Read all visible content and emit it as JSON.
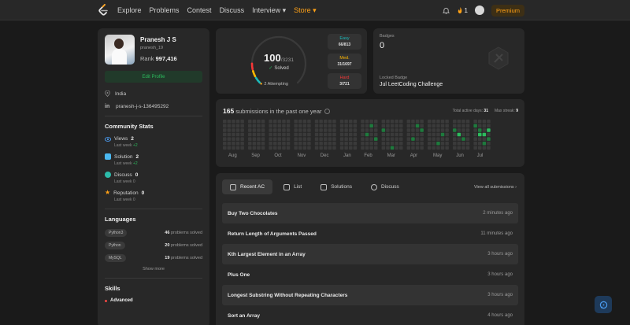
{
  "nav": {
    "links": [
      "Explore",
      "Problems",
      "Contest",
      "Discuss",
      "Interview ▾",
      "Store ▾"
    ],
    "streak": "1",
    "premium": "Premium"
  },
  "profile": {
    "name": "Pranesh J S",
    "username": "pranesh_19",
    "rank_label": "Rank",
    "rank": "997,416",
    "edit_label": "Edit Profile",
    "location": "India",
    "linkedin": "pranesh-j-s-136495292"
  },
  "community": {
    "title": "Community Stats",
    "items": [
      {
        "label": "Views",
        "value": "2",
        "sub": "Last week",
        "delta": "+2",
        "color": "#4b9cf0"
      },
      {
        "label": "Solution",
        "value": "2",
        "sub": "Last week",
        "delta": "+2",
        "color": "#4bb8f0"
      },
      {
        "label": "Discuss",
        "value": "0",
        "sub": "Last week",
        "delta": "0",
        "color": "#2cbbaa"
      },
      {
        "label": "Reputation",
        "value": "0",
        "sub": "Last week",
        "delta": "0",
        "color": "#ffa116"
      }
    ]
  },
  "languages": {
    "title": "Languages",
    "items": [
      {
        "name": "Python3",
        "count": "46",
        "suffix": "problems solved"
      },
      {
        "name": "Python",
        "count": "20",
        "suffix": "problems solved"
      },
      {
        "name": "MySQL",
        "count": "19",
        "suffix": "problems solved"
      }
    ],
    "show_more": "Show more"
  },
  "skills": {
    "title": "Skills",
    "first": "Advanced"
  },
  "solved": {
    "count": "100",
    "total": "/3231",
    "label": "Solved",
    "attempting": "2 Attempting",
    "ring": {
      "easy": 66,
      "medium": 31,
      "hard": 3,
      "total": 3231
    },
    "difficulty": [
      {
        "label": "Easy",
        "value": "66/813",
        "color": "#1cbaba"
      },
      {
        "label": "Med.",
        "value": "31/1697",
        "color": "#ffb700"
      },
      {
        "label": "Hard",
        "value": "3/721",
        "color": "#f63737"
      }
    ]
  },
  "badges": {
    "label": "Badges",
    "count": "0",
    "locked_label": "Locked Badge",
    "locked_name": "Jul LeetCoding Challenge"
  },
  "calendar": {
    "count": "165",
    "title_rest": "submissions in the past one year",
    "active_label": "Total active days:",
    "active": "31",
    "streak_label": "Max streak:",
    "streak": "9",
    "months": [
      "Aug",
      "Sep",
      "Oct",
      "Nov",
      "Dec",
      "Jan",
      "Feb",
      "Mar",
      "Apr",
      "May",
      "Jun",
      "Jul"
    ]
  },
  "recent": {
    "tabs": [
      "Recent AC",
      "List",
      "Solutions",
      "Discuss"
    ],
    "view_all": "View all submissions ›",
    "rows": [
      {
        "title": "Buy Two Chocolates",
        "when": "2 minutes ago"
      },
      {
        "title": "Return Length of Arguments Passed",
        "when": "11 minutes ago"
      },
      {
        "title": "Kth Largest Element in an Array",
        "when": "3 hours ago"
      },
      {
        "title": "Plus One",
        "when": "3 hours ago"
      },
      {
        "title": "Longest Substring Without Repeating Characters",
        "when": "3 hours ago"
      },
      {
        "title": "Sort an Array",
        "when": "4 hours ago"
      }
    ]
  },
  "colors": {
    "accent": "#ffa116",
    "green": "#2cbb5d",
    "card": "#282828"
  }
}
